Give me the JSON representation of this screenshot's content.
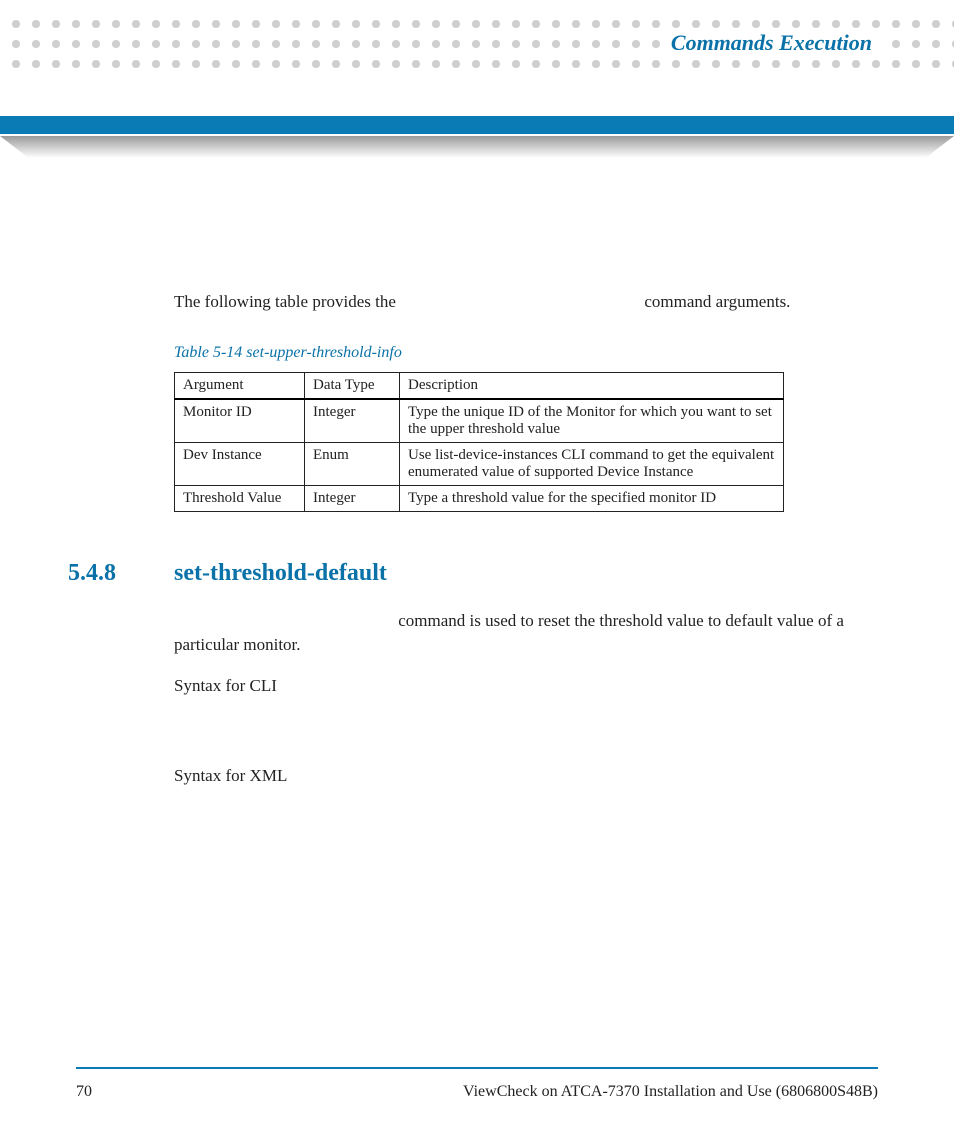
{
  "header": {
    "title": "Commands Execution"
  },
  "intro": {
    "pre": "The following table provides the",
    "post": "command arguments."
  },
  "table": {
    "caption": "Table 5-14 set-upper-threshold-info",
    "headers": {
      "arg": "Argument",
      "dt": "Data Type",
      "desc": "Description"
    },
    "rows": [
      {
        "arg": "Monitor ID",
        "dt": "Integer",
        "desc": "Type the unique ID of the Monitor for which you want to set the upper threshold value"
      },
      {
        "arg": "Dev Instance",
        "dt": "Enum",
        "desc": "Use list-device-instances CLI command to get the equivalent enumerated value of supported Device Instance"
      },
      {
        "arg": "Threshold Value",
        "dt": "Integer",
        "desc": "Type a threshold value for the specified monitor ID"
      }
    ]
  },
  "section": {
    "number": "5.4.8",
    "title": "set-threshold-default",
    "body": "command is used to reset the threshold value to default value of a particular monitor.",
    "syntax_cli": "Syntax for CLI",
    "syntax_xml": "Syntax for XML"
  },
  "footer": {
    "page": "70",
    "doc": "ViewCheck on ATCA-7370 Installation and Use (6806800S48B)"
  }
}
